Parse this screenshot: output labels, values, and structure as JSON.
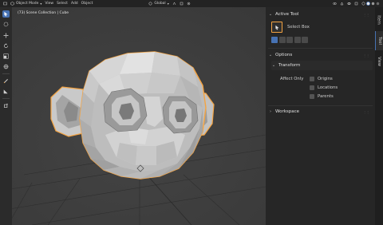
{
  "header": {
    "mode_label": "Object Mode",
    "menus": [
      "View",
      "Select",
      "Add",
      "Object"
    ],
    "orientation_label": "Global"
  },
  "viewport": {
    "frame_label": "(73) Scene Collection | Cube"
  },
  "sidebar": {
    "active_tool_title": "Active Tool",
    "select_box_label": "Select Box",
    "options_title": "Options",
    "transform_title": "Transform",
    "affect_only_label": "Affect Only",
    "checkboxes": [
      "Origins",
      "Locations",
      "Parents"
    ],
    "workspace_title": "Workspace"
  },
  "tabs": [
    "Item",
    "Tool",
    "View"
  ],
  "colors": {
    "accent": "#4772b3",
    "selection_outline": "#f5a442",
    "background": "#3b3b3b"
  }
}
